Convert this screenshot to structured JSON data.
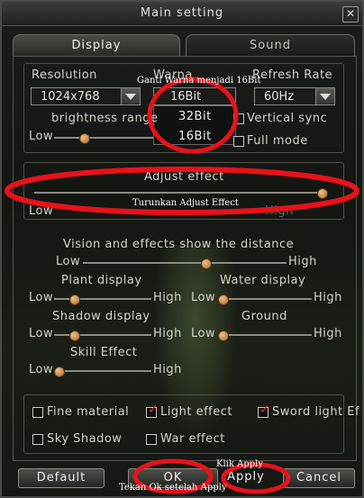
{
  "window": {
    "title": "Main setting",
    "close_glyph": "✕"
  },
  "tabs": [
    {
      "label": "Display",
      "active": true
    },
    {
      "label": "Sound",
      "active": false
    }
  ],
  "display": {
    "resolution": {
      "label": "Resolution",
      "value": "1024x768"
    },
    "warna": {
      "label_partial": "Warna",
      "value": "16Bit",
      "options": [
        "32Bit",
        "16Bit"
      ]
    },
    "refresh": {
      "label": "Refresh Rate",
      "value": "60Hz"
    },
    "brightness": {
      "label": "brightness range",
      "low": "Low",
      "level": 0.3
    },
    "vertical_sync": {
      "label": "Vertical sync",
      "checked": false
    },
    "full_mode": {
      "label": "Full mode",
      "checked": false
    }
  },
  "adjust": {
    "label": "Adjust effect",
    "low": "Low",
    "high": "High",
    "level": 0.98
  },
  "vision": {
    "label": "Vision and effects show the distance",
    "low": "Low",
    "high": "High",
    "level": 0.6
  },
  "plant": {
    "label": "Plant display",
    "low": "Low",
    "high": "High",
    "level": 0.2
  },
  "water": {
    "label": "Water display",
    "low": "Low",
    "high": "High",
    "level": 0.05
  },
  "shadow": {
    "label": "Shadow display",
    "low": "Low",
    "high": "High",
    "level": 0.2
  },
  "ground": {
    "label": "Ground",
    "low": "Low",
    "high": "High",
    "level": 0.05
  },
  "skill": {
    "label": "Skill Effect",
    "low": "Low",
    "high": "High",
    "level": 0.05
  },
  "options": [
    {
      "label": "Fine material",
      "checked": false
    },
    {
      "label": "Light effect",
      "checked": true
    },
    {
      "label": "Sword light Ef",
      "checked": true
    },
    {
      "label": "Sky Shadow",
      "checked": false
    },
    {
      "label": "War effect",
      "checked": false
    }
  ],
  "buttons": {
    "default": "Default",
    "ok": "OK",
    "apply": "Apply",
    "cancel": "Cancel"
  },
  "annotations": {
    "warna_note": "Ganti Warna menjadi 16Bit",
    "adjust_note": "Turunkan Adjust Effect",
    "apply_note": "Klik Apply",
    "ok_note": "Tekan Ok setelah Apply"
  },
  "colors": {
    "annotation_red": "#e8121a",
    "check_red": "#e23333",
    "slider_knob": "#c88a4a"
  }
}
